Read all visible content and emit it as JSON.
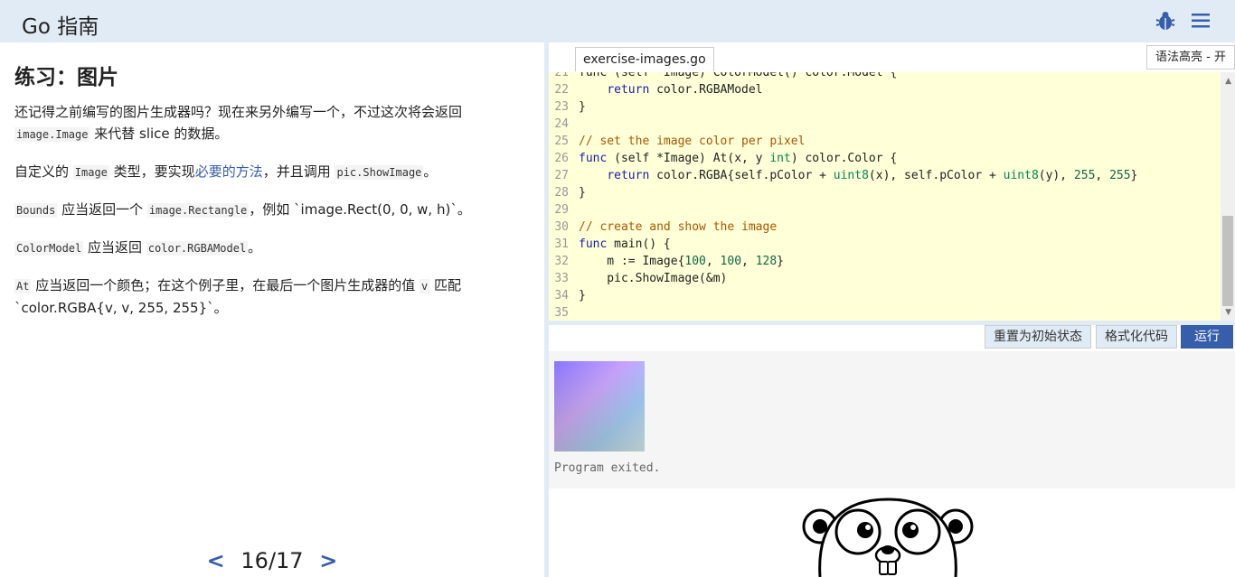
{
  "header": {
    "title": "Go 指南",
    "bug_icon": "bug-icon",
    "menu_icon": "menu-icon"
  },
  "lesson": {
    "title": "练习：图片",
    "p1_text_a": "还记得之前编写的图片生成器吗？现在来另外编写一个，不过这次将会返回",
    "p1_code": "image.Image",
    "p1_text_b": " 来代替 slice 的数据。",
    "p2_text_a": "自定义的 ",
    "p2_code_a": "Image",
    "p2_text_b": " 类型，要实现",
    "p2_link": "必要的方法",
    "p2_text_c": "，并且调用 ",
    "p2_code_b": "pic.ShowImage",
    "p2_text_d": "。",
    "p3_code_a": "Bounds",
    "p3_text_a": " 应当返回一个 ",
    "p3_code_b": "image.Rectangle",
    "p3_text_b": "，例如 `image.Rect(0, 0, w, h)`。",
    "p4_code_a": "ColorModel",
    "p4_text_a": " 应当返回 ",
    "p4_code_b": "color.RGBAModel",
    "p4_text_b": "。",
    "p5_code_a": "At",
    "p5_text_a": " 应当返回一个颜色；在这个例子里，在最后一个图片生成器的值 ",
    "p5_code_b": "v",
    "p5_text_b": " 匹配 `color.RGBA{v, v, 255, 255}`。"
  },
  "pager": {
    "prev": "<",
    "current": "16/17",
    "next": ">"
  },
  "editor": {
    "file_tab": "exercise-images.go",
    "syntax_toggle": "语法高亮 - 开",
    "partial_line": "func (self *Image) ColorModel() color.Model {",
    "lines": [
      {
        "n": "22",
        "code": "    return color.RGBAModel"
      },
      {
        "n": "23",
        "code": "}"
      },
      {
        "n": "24",
        "code": ""
      },
      {
        "n": "25",
        "code": "// set the image color per pixel"
      },
      {
        "n": "26",
        "code": "func (self *Image) At(x, y int) color.Color {"
      },
      {
        "n": "27",
        "code": "    return color.RGBA{self.pColor + uint8(x), self.pColor + uint8(y), 255, 255}"
      },
      {
        "n": "28",
        "code": "}"
      },
      {
        "n": "29",
        "code": ""
      },
      {
        "n": "30",
        "code": "// create and show the image"
      },
      {
        "n": "31",
        "code": "func main() {"
      },
      {
        "n": "32",
        "code": "    m := Image{100, 100, 128}"
      },
      {
        "n": "33",
        "code": "    pic.ShowImage(&m)"
      },
      {
        "n": "34",
        "code": "}"
      },
      {
        "n": "35",
        "code": ""
      }
    ]
  },
  "toolbar": {
    "reset": "重置为初始状态",
    "format": "格式化代码",
    "run": "运行"
  },
  "output": {
    "status": "Program exited."
  }
}
